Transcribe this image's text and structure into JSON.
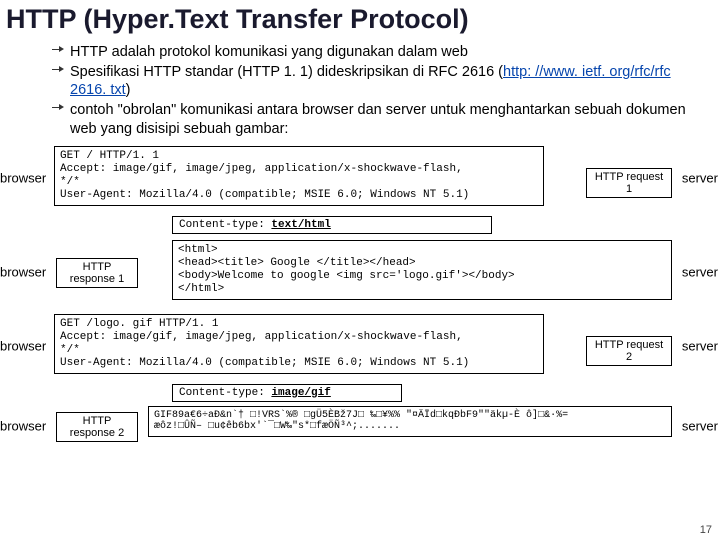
{
  "title": "HTTP (Hyper.Text Transfer Protocol)",
  "bullets": {
    "b1": "HTTP adalah protokol komunikasi yang digunakan dalam web",
    "b2a": "Spesifikasi HTTP standar (HTTP 1. 1) dideskripsikan di RFC 2616 (",
    "b2link": "http: //www. ietf. org/rfc/rfc 2616. txt",
    "b2b": ")",
    "b3": "contoh \"obrolan\" komunikasi antara browser dan server untuk menghantarkan sebuah dokumen web yang disisipi sebuah gambar:"
  },
  "actors": {
    "browser": "browser",
    "server": "server"
  },
  "req1": "GET / HTTP/1. 1\nAccept: image/gif, image/jpeg, application/x-shockwave-flash,\n*/*\nUser-Agent: Mozilla/4.0 (compatible; MSIE 6.0; Windows NT 5.1)",
  "label_req1": "HTTP request 1",
  "ct1": {
    "pre": "Content-type: ",
    "val": "text/html"
  },
  "label_resp1": "HTTP response 1",
  "resp1": "<html>\n<head><title> Google </title></head>\n<body>Welcome to google <img src='logo.gif'></body>\n</html>",
  "req2": "GET /logo. gif HTTP/1. 1\nAccept: image/gif, image/jpeg, application/x-shockwave-flash,\n*/*\nUser-Agent: Mozilla/4.0 (compatible; MSIE 6.0; Windows NT 5.1)",
  "label_req2": "HTTP request 2",
  "ct2": {
    "pre": "Content-type: ",
    "val": "image/gif"
  },
  "label_resp2": "HTTP response 2",
  "resp2": "GIF89a€6÷aÐ&n`† □!VRS`%® □gÜ5ÈBž7J□ ‰□¥%% \"¤ÄÏd□kqÐbF9\"\"äkµ-È ô]□&·%=\næôz!□ÛÑ– □u¢êb6bx'`¯□W‰\"s*□fæÖÑ³^;.......",
  "pagenum": "17"
}
